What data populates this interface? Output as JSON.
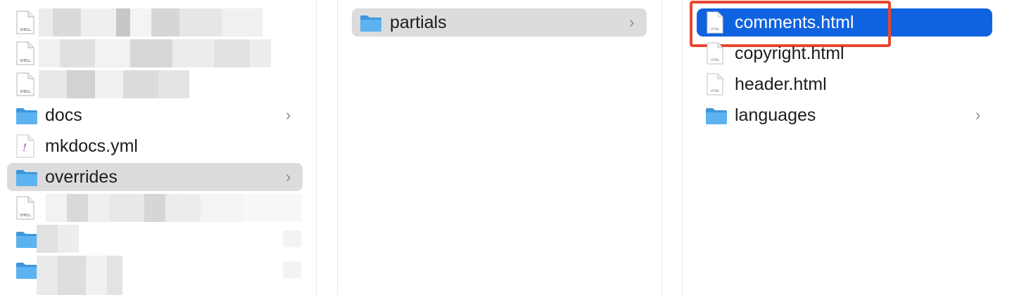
{
  "column1": {
    "items": [
      {
        "name": "",
        "kind": "shell-doc",
        "icon_label": "SHELL"
      },
      {
        "name": "",
        "kind": "shell-doc",
        "icon_label": "SHELL"
      },
      {
        "name": "",
        "kind": "shell-doc",
        "icon_label": "SHELL"
      },
      {
        "name": "docs",
        "kind": "folder",
        "has_children": true
      },
      {
        "name": "mkdocs.yml",
        "kind": "yaml-doc",
        "icon_label": "!"
      },
      {
        "name": "overrides",
        "kind": "folder",
        "has_children": true,
        "selected": true
      },
      {
        "name": "",
        "kind": "shell-doc",
        "icon_label": "SHELL"
      },
      {
        "name": "",
        "kind": "folder"
      },
      {
        "name": "",
        "kind": "folder"
      }
    ]
  },
  "column2": {
    "items": [
      {
        "name": "partials",
        "kind": "folder",
        "has_children": true,
        "selected": true
      }
    ]
  },
  "column3": {
    "items": [
      {
        "name": "comments.html",
        "kind": "html-doc",
        "icon_label": "HTML",
        "selected": true,
        "highlighted": true
      },
      {
        "name": "copyright.html",
        "kind": "html-doc",
        "icon_label": "HTML"
      },
      {
        "name": "header.html",
        "kind": "html-doc",
        "icon_label": "HTML"
      },
      {
        "name": "languages",
        "kind": "folder",
        "has_children": true
      }
    ]
  },
  "chevron": "›",
  "colors": {
    "selection_blue": "#0f63e0",
    "selection_gray": "#dcdcdc",
    "folder_blue": "#4aa8ea",
    "highlight_box": "#e8472e"
  }
}
